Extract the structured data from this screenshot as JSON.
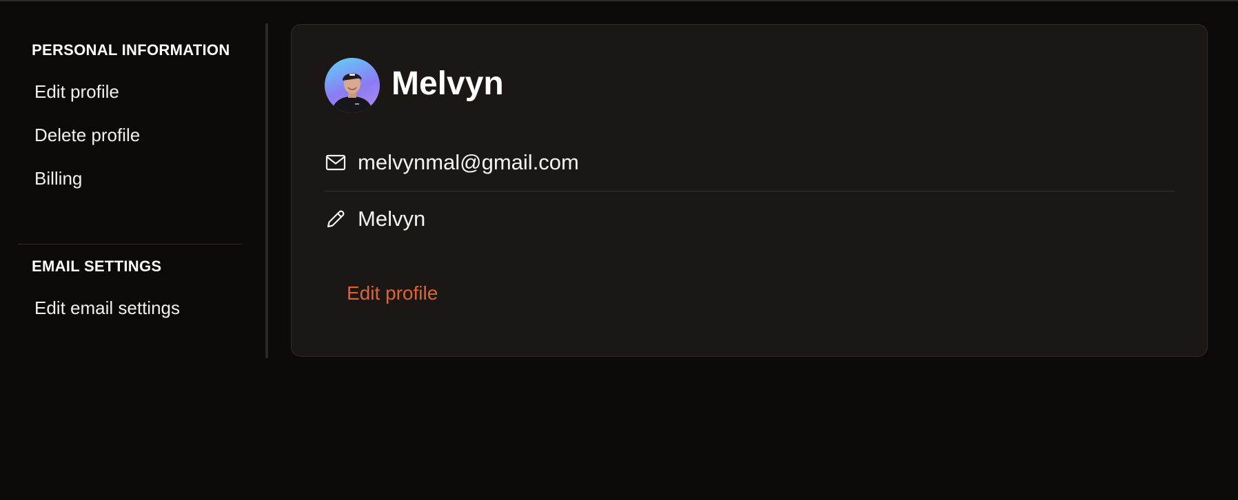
{
  "sidebar": {
    "personal_heading": "PERSONAL INFORMATION",
    "personal_items": [
      {
        "label": "Edit profile"
      },
      {
        "label": "Delete profile"
      },
      {
        "label": "Billing"
      }
    ],
    "email_heading": "EMAIL SETTINGS",
    "email_items": [
      {
        "label": "Edit email settings"
      }
    ]
  },
  "profile": {
    "name": "Melvyn",
    "avatar_icon": "user-avatar-photo",
    "email": "melvynmal@gmail.com",
    "email_icon": "mail-icon",
    "display_name": "Melvyn",
    "display_name_icon": "pencil-icon",
    "edit_label": "Edit profile"
  },
  "colors": {
    "background": "#0b0a09",
    "card": "#1a1714",
    "accent": "#e0642f",
    "text": "#f5f3f0"
  }
}
